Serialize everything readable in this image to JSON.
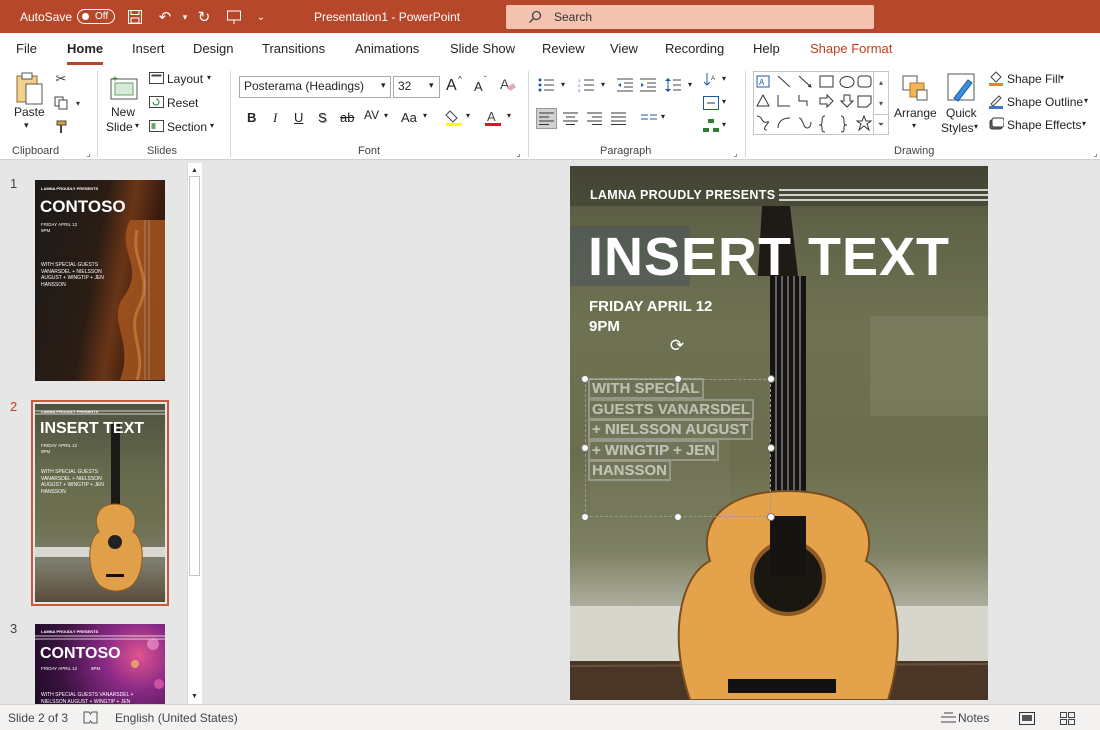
{
  "titlebar": {
    "autosave_label": "AutoSave",
    "autosave_state": "Off",
    "document_title": "Presentation1  -  PowerPoint",
    "search_placeholder": "Search",
    "accent_color": "#b7472a"
  },
  "tabs": [
    {
      "label": "File",
      "active": false
    },
    {
      "label": "Home",
      "active": true
    },
    {
      "label": "Insert",
      "active": false
    },
    {
      "label": "Design",
      "active": false
    },
    {
      "label": "Transitions",
      "active": false
    },
    {
      "label": "Animations",
      "active": false
    },
    {
      "label": "Slide Show",
      "active": false
    },
    {
      "label": "Review",
      "active": false
    },
    {
      "label": "View",
      "active": false
    },
    {
      "label": "Recording",
      "active": false
    },
    {
      "label": "Help",
      "active": false
    },
    {
      "label": "Shape Format",
      "active": false,
      "contextual": true
    }
  ],
  "ribbon": {
    "clipboard": {
      "label": "Clipboard",
      "paste": "Paste"
    },
    "slides": {
      "label": "Slides",
      "new_slide_1": "New",
      "new_slide_2": "Slide",
      "layout": "Layout",
      "reset": "Reset",
      "section": "Section"
    },
    "font": {
      "label": "Font",
      "font_name": "Posterama (Headings)",
      "font_size": "32",
      "bold": "B",
      "italic": "I",
      "underline": "U",
      "shadow": "S",
      "strike": "ab",
      "spacing": "AV",
      "case": "Aa",
      "grow": "A",
      "shrink": "A"
    },
    "paragraph": {
      "label": "Paragraph"
    },
    "drawing": {
      "label": "Drawing",
      "arrange": "Arrange",
      "quick_styles_1": "Quick",
      "quick_styles_2": "Styles",
      "shape_fill": "Shape Fill",
      "shape_outline": "Shape Outline",
      "shape_effects": "Shape Effects"
    }
  },
  "thumbnails": [
    {
      "number": "1",
      "presents": "LAMNA PROUDLY PRESENTS",
      "title": "CONTOSO",
      "date": "FRIDAY APRIL 12",
      "time": "9PM",
      "guests": "WITH SPECIAL GUESTS VANARSDEL + NIELSSON AUGUST + WINGTIP + JEN HANSSON"
    },
    {
      "number": "2",
      "presents": "LAMNA PROUDLY PRESENTS",
      "title": "INSERT TEXT",
      "date": "FRIDAY APRIL 12",
      "time": "9PM",
      "guests": "WITH SPECIAL GUESTS VANARSDEL + NIELSSON AUGUST + WINGTIP + JEN HANSSON"
    },
    {
      "number": "3",
      "presents": "LAMNA PROUDLY PRESENTS",
      "title": "CONTOSO",
      "date": "FRIDAY APRIL 12",
      "time": "9PM",
      "guests": "WITH SPECIAL GUESTS VANARSDEL + NIELSSON AUGUST + WINGTIP + JEN HANSSON"
    }
  ],
  "slide": {
    "presents": "LAMNA PROUDLY PRESENTS",
    "title": "INSERT TEXT",
    "date": "FRIDAY APRIL 12",
    "time": "9PM",
    "guest_lines": [
      "WITH SPECIAL",
      "GUESTS VANARSDEL",
      "+ NIELSSON AUGUST",
      "+ WINGTIP + JEN",
      "HANSSON"
    ]
  },
  "statusbar": {
    "slide_indicator": "Slide 2 of 3",
    "language": "English (United States)",
    "notes": "Notes"
  }
}
